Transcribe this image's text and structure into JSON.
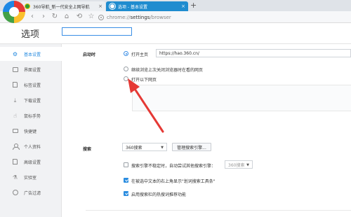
{
  "browser": {
    "tabs": [
      {
        "label": "360导航_新一代安全上网导航",
        "active": false
      },
      {
        "label": "选项 - 基本设置",
        "active": true
      }
    ],
    "address": {
      "scheme": "chrome://",
      "highlight": "settings",
      "path": "/browser"
    }
  },
  "header": {
    "title": "选项",
    "search_placeholder": ""
  },
  "sidebar": {
    "items": [
      {
        "label": "基本设置",
        "icon": "gear-icon",
        "active": true
      },
      {
        "label": "界面设置",
        "icon": "window-icon",
        "active": false
      },
      {
        "label": "标签设置",
        "icon": "tabs-icon",
        "active": false
      },
      {
        "label": "下载设置",
        "icon": "download-icon",
        "active": false
      },
      {
        "label": "鼠标手势",
        "icon": "mouse-gesture-icon",
        "active": false
      },
      {
        "label": "快捷键",
        "icon": "keyboard-icon",
        "active": false
      },
      {
        "label": "个人资料",
        "icon": "user-icon",
        "active": false
      },
      {
        "label": "高级设置",
        "icon": "advanced-icon",
        "active": false
      },
      {
        "label": "实验室",
        "icon": "lab-icon",
        "active": false
      },
      {
        "label": "广告过滤",
        "icon": "block-icon",
        "active": false
      }
    ]
  },
  "startup": {
    "label": "启动时",
    "options": [
      {
        "label": "打开主页",
        "checked": true
      },
      {
        "label": "继续浏览上次关闭浏览器时在看的网页",
        "checked": false
      },
      {
        "label": "打开以下网页",
        "checked": false
      }
    ],
    "homepage_value": "https://hao.360.cn/"
  },
  "search": {
    "label": "搜索",
    "engine": "360搜索",
    "manage_button": "管理搜索引擎...",
    "auto_switch_label": "搜索引擎不稳定时，自动尝试其他搜索引擎：",
    "auto_switch_checked": false,
    "fallback_engine": "360搜索",
    "popup_tool_label": "在被选中文本的右上角显示\"划词搜索工具条\"",
    "popup_tool_checked": true,
    "suggest_label": "启用搜索栏的热搜词推荐功能",
    "suggest_checked": true
  },
  "colors": {
    "accent": "#2b8de0",
    "active_tab": "#1f8ccf",
    "annotation_arrow": "#e53935"
  }
}
